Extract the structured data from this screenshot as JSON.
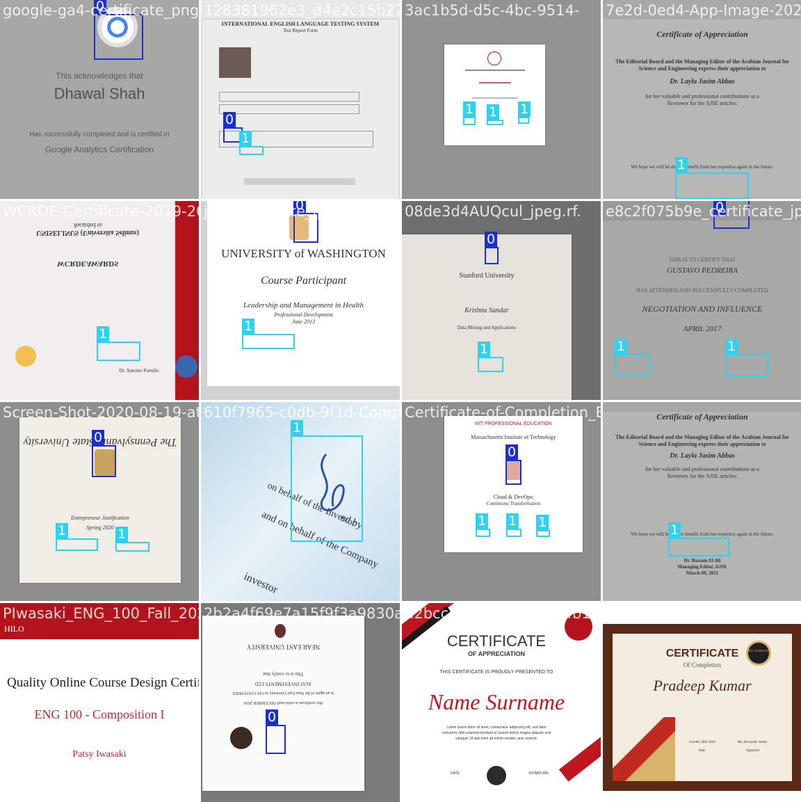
{
  "classes": {
    "0": "0",
    "1": "1"
  },
  "colors": {
    "class0": "#1a2fd1",
    "class1": "#2fd2ee",
    "tile_bg": "#8a8a8a",
    "red": "#b3141c"
  },
  "tiles": [
    {
      "filename": "google-ga4-certificate_png.rf.",
      "lines": [
        "This acknowledges that",
        "Dhawal Shah",
        "Has successfully completed and is certified in",
        "Google Analytics Certification"
      ],
      "boxes": [
        {
          "cls": "0"
        }
      ]
    },
    {
      "filename": "128381962e3_d4e2c15b2208_o_jpg.rf.00851a3de4-9514-78ad-W7-7a-0e-jpg",
      "lines": [
        "INTERNATIONAL ENGLISH LANGUAGE TESTING SYSTEM",
        "Test Report Form"
      ],
      "boxes": [
        {
          "cls": "0"
        },
        {
          "cls": "1"
        }
      ]
    },
    {
      "filename": "3ac1b5d-d5c-4bc-9514-",
      "lines": [],
      "boxes": [
        {
          "cls": "1"
        },
        {
          "cls": "1"
        },
        {
          "cls": "1"
        }
      ]
    },
    {
      "filename": "7e2d-0ed4-App-Image-202",
      "lines": [
        "Certificate of Appreciation",
        "The Editorial Board and the Managing Editor of the Arabian Journal for",
        "Science and Engineering express their appreciation to",
        "Dr. Layla Jasim Abbas",
        "for her valuable and professional contributions as a",
        "Reviewer for the AJSE articles:",
        "We hope we will be able to benefit from her expertise again in the future."
      ],
      "boxes": [
        {
          "cls": "1"
        },
        {
          "cls": "0"
        }
      ]
    },
    {
      "filename": "WCRDE-Certificate-2019-2020_jpg.rf.",
      "lines": [
        "Awarded to",
        "UNISELINUS (Universita Selinus)",
        "WCRDEAWARDS",
        "Dr. Antonio Pomilio"
      ],
      "boxes": [
        {
          "cls": "1"
        }
      ]
    },
    {
      "filename": "jpg-certificate_jpeg.rf.21",
      "lines": [
        "UNIVERSITY of WASHINGTON",
        "Course Participant",
        "Leadership and Management in Health",
        "Professional Development",
        "June 2013"
      ],
      "boxes": [
        {
          "cls": "0"
        },
        {
          "cls": "1"
        }
      ]
    },
    {
      "filename": "08de3d4AUQcul_jpeg.rf.",
      "lines": [
        "Stanford University",
        "Krishna Sundar",
        "Data Mining and Applications"
      ],
      "boxes": [
        {
          "cls": "0"
        },
        {
          "cls": "1"
        }
      ]
    },
    {
      "filename": "e8c2f075b9e_certificate_jpg.",
      "lines": [
        "THIS IS TO CERTIFY THAT",
        "GUSTAVO PEDREIRA",
        "HAS ATTENDED AND SUCCESSFULLY COMPLETED",
        "NEGOTIATION AND INFLUENCE",
        "APRIL 2017"
      ],
      "boxes": [
        {
          "cls": "1"
        },
        {
          "cls": "1"
        },
        {
          "cls": "0"
        }
      ]
    },
    {
      "filename": "Screen-Shot-2020-08-19-at-6.45.14-AM-jpg.rf.",
      "lines": [
        "The Pennsylvania State University",
        "Entrepreneur Justification",
        "Spring 2020"
      ],
      "boxes": [
        {
          "cls": "0"
        },
        {
          "cls": "1"
        },
        {
          "cls": "1"
        }
      ]
    },
    {
      "filename": "610f7965-c0db-9f1d-Completion_Et",
      "lines": [
        "on behalf of the Investor",
        "and on behalf of the Company",
        "ed by",
        "investor"
      ],
      "boxes": [
        {
          "cls": "1"
        }
      ]
    },
    {
      "filename": "Certificate-of-Completion_E7834-Whats-App-Image-2021",
      "lines": [
        "MIT PROFESSIONAL EDUCATION",
        "Massachusetts Institute of Technology",
        "Cloud & DevOps:",
        "Continuous Transformation"
      ],
      "boxes": [
        {
          "cls": "0"
        },
        {
          "cls": "1"
        },
        {
          "cls": "1"
        },
        {
          "cls": "1"
        }
      ]
    },
    {
      "filename": "",
      "lines": [
        "Certificate of Appreciation",
        "The Editorial Board and the Managing Editor of the Arabian Journal for",
        "Science and Engineering express their appreciation to",
        "Dr. Layla Jasim Abbas",
        "for her valuable and professional contributions as a",
        "Reviewer for the AJSE articles:",
        "We hope we will be able to benefit from her expertise again in the future.",
        "Dr. Bassam El Ali",
        "Managing Editor, AJSE",
        "March 09, 2021"
      ],
      "boxes": [
        {
          "cls": "1"
        }
      ]
    },
    {
      "filename": "PIwasaki_ENG_100_Fall_2020_jpg.rf.",
      "lines": [
        "HILO",
        "Quality Online Course Design Certific",
        "ENG 100 - Composition I",
        "Patsy Iwasaki"
      ],
      "boxes": []
    },
    {
      "filename": "2b2a4f69e7a15f9f3a9830ae2",
      "lines": [
        "NEAR EAST UNIVERSITY",
        "This is to certify that",
        "ALVI INVESTMENTS LTD",
        "Is an agent of the Near East University in CIS COUNTRIES",
        "this certificate is valid until DECEMBER 2018"
      ],
      "boxes": [
        {
          "cls": "0"
        }
      ]
    },
    {
      "filename": "d2bcc5e3a9bda-3b5c4b149a347c",
      "lines": [
        "CERTIFICATE",
        "OF APPRECIATION",
        "THIS CERTIFICATE IS PROUDLY PRESENTED TO",
        "Name Surname",
        "Lorem ipsum dolor sit amet, consectetur adipiscing elit, sed diam",
        "nonummy nibh euismod tincidunt ut laoreet dolore magna aliquam erat",
        "volutpat. Ut wisi enim ad minim veniam, quis nostrud.",
        "DATE",
        "SIGNATURE"
      ],
      "boxes": []
    },
    {
      "filename": "",
      "lines": [
        "CERTIFICATE",
        "Of Completion",
        "Pradeep Kumar",
        "October 28th 2018",
        "Mr. Alexander Smith",
        "Date",
        "Signature",
        "BEST AWARD 2018"
      ],
      "boxes": []
    }
  ]
}
